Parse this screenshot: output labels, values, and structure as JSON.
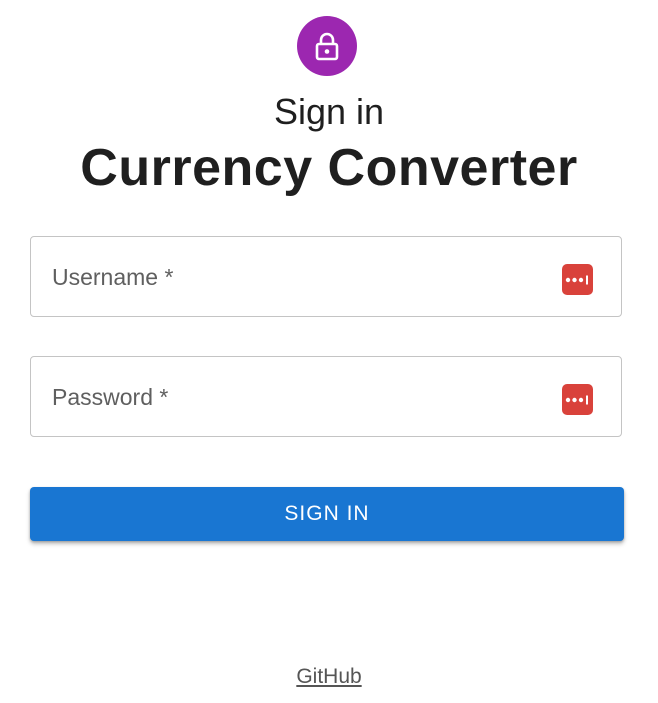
{
  "header": {
    "avatar_icon": "lock-icon",
    "subtitle": "Sign in",
    "title": "Currency Converter"
  },
  "form": {
    "username": {
      "label": "Username *",
      "value": "",
      "password_manager_icon": "password-manager-icon"
    },
    "password": {
      "label": "Password *",
      "value": "",
      "password_manager_icon": "password-manager-icon"
    },
    "submit_label": "SIGN IN"
  },
  "footer": {
    "link_label": "GitHub"
  },
  "colors": {
    "avatar_bg": "#9c27b0",
    "primary_button": "#1976d2",
    "password_manager_badge": "#d9423b"
  }
}
